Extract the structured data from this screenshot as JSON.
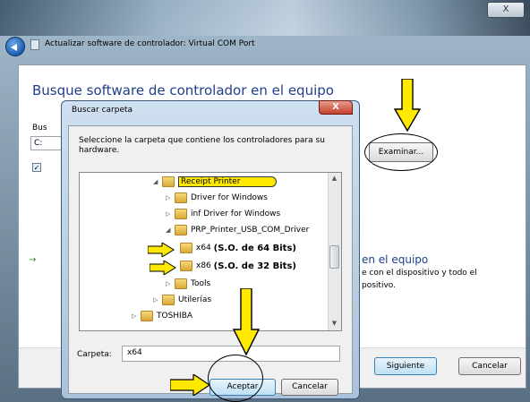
{
  "window": {
    "close_glyph": "X",
    "title": "Actualizar software de controlador: Virtual COM Port"
  },
  "wizard": {
    "heading": "Busque software de controlador en el equipo",
    "frag_bus": "Bus",
    "frag_c": "C:",
    "browse_button": "Examinar...",
    "frag_en_equipo": "en el equipo",
    "frag_line2": "e con el dispositivo y todo el",
    "frag_line3": "positivo.",
    "next_button": "Siguiente",
    "cancel_button": "Cancelar"
  },
  "dialog": {
    "title": "Buscar carpeta",
    "close_glyph": "X",
    "description": "Seleccione la carpeta que contiene los controladores para su hardware.",
    "tree": [
      {
        "label": "Receipt Printer",
        "expander": "◢",
        "highlight": true
      },
      {
        "label": "Driver for Windows",
        "expander": "▷"
      },
      {
        "label": "inf Driver for Windows",
        "expander": "▷"
      },
      {
        "label": "PRP_Printer_USB_COM_Driver",
        "expander": "◢"
      },
      {
        "label": "x64",
        "note": "(S.O. de 64 Bits)"
      },
      {
        "label": "x86",
        "note": "(S.O. de 32 Bits)"
      },
      {
        "label": "Tools",
        "expander": "▷"
      },
      {
        "label": "Utilerías",
        "expander": "▷"
      },
      {
        "label": "TOSHIBA",
        "expander": "▷"
      }
    ],
    "folder_label": "Carpeta:",
    "folder_value": "x64",
    "accept_button": "Aceptar",
    "cancel_button": "Cancelar"
  },
  "colors": {
    "annotation_yellow": "#ffe900",
    "heading_blue": "#1e3f8a"
  }
}
